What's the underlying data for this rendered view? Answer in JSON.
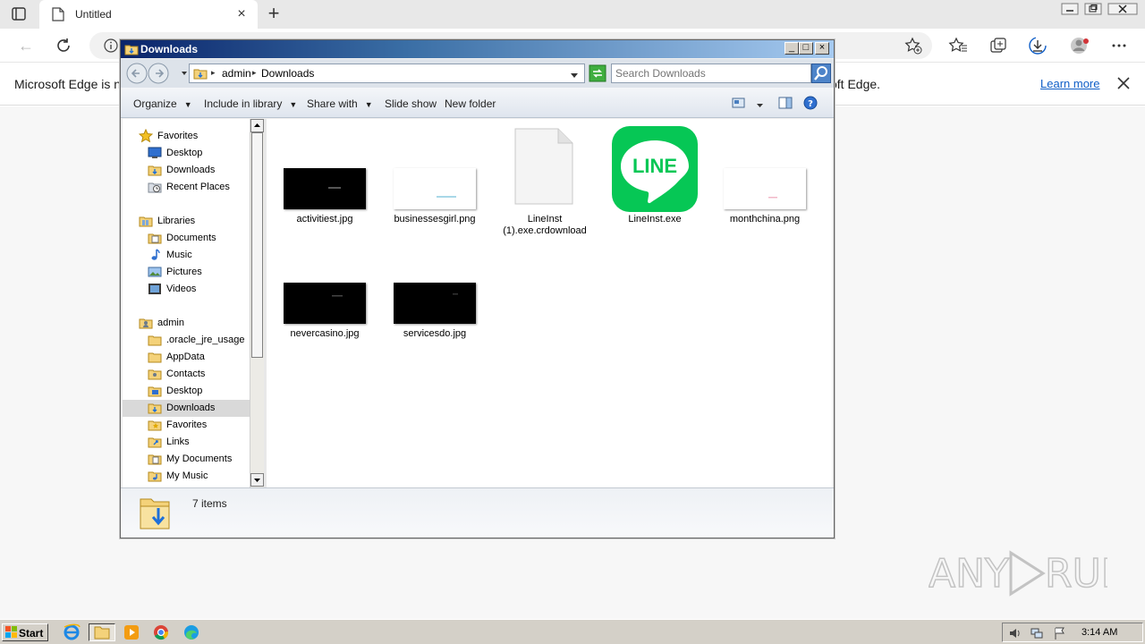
{
  "browser": {
    "tab_title": "Untitled",
    "infobar_left": "Microsoft Edge is no",
    "infobar_right": "oft Edge.",
    "learn_more": "Learn more"
  },
  "explorer": {
    "title": "Downloads",
    "breadcrumb": [
      "admin",
      "Downloads"
    ],
    "search_placeholder": "Search Downloads",
    "commands": {
      "organize": "Organize",
      "include": "Include in library",
      "share": "Share with",
      "slideshow": "Slide show",
      "new_folder": "New folder"
    },
    "nav": {
      "favorites": "Favorites",
      "desktop": "Desktop",
      "downloads": "Downloads",
      "recent": "Recent Places",
      "libraries": "Libraries",
      "documents": "Documents",
      "music": "Music",
      "pictures": "Pictures",
      "videos": "Videos",
      "admin": "admin",
      "oracle": ".oracle_jre_usage",
      "appdata": "AppData",
      "contacts": "Contacts",
      "desktop2": "Desktop",
      "downloads2": "Downloads",
      "favorites2": "Favorites",
      "links": "Links",
      "mydocs": "My Documents",
      "mymusic": "My Music"
    },
    "files": [
      {
        "name": "activitiest.jpg",
        "icon": "dark-image-thumbnail"
      },
      {
        "name": "businessesgirl.png",
        "icon": "light-image-thumbnail"
      },
      {
        "name": "LineInst (1).exe.crdownload",
        "icon": "blank-file-icon"
      },
      {
        "name": "LineInst.exe",
        "icon": "line-app-icon",
        "icon_text": "LINE"
      },
      {
        "name": "monthchina.png",
        "icon": "light-image-thumbnail"
      },
      {
        "name": "nevercasino.jpg",
        "icon": "dark-image-thumbnail"
      },
      {
        "name": "servicesdo.jpg",
        "icon": "dark-image-thumbnail"
      }
    ],
    "status": "7 items"
  },
  "taskbar": {
    "start": "Start",
    "clock": "3:14 AM"
  },
  "watermark": "ANY RUN"
}
